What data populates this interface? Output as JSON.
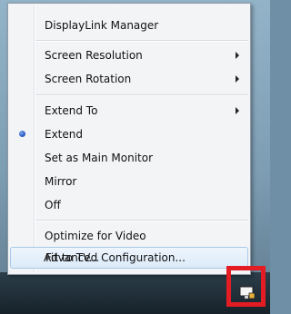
{
  "menu": {
    "items": [
      {
        "label": "DisplayLink Manager",
        "submenu": false
      },
      {
        "label": "Screen Resolution",
        "submenu": true
      },
      {
        "label": "Screen Rotation",
        "submenu": true
      },
      {
        "label": "Extend To",
        "submenu": true
      },
      {
        "label": "Extend",
        "submenu": false,
        "selected": true
      },
      {
        "label": "Set as Main Monitor",
        "submenu": false
      },
      {
        "label": "Mirror",
        "submenu": false
      },
      {
        "label": "Off",
        "submenu": false
      },
      {
        "label": "Optimize for Video",
        "submenu": false
      },
      {
        "label": "Fit to TV...",
        "submenu": false,
        "highlighted": true
      },
      {
        "label": "Advanced Configuration...",
        "submenu": false
      }
    ]
  },
  "tray": {
    "icon": "displaylink-tray-icon"
  },
  "colors": {
    "highlight_box": "#e31d23",
    "menu_bg": "#f2f4f6",
    "hover_border": "#a8c8e8"
  }
}
